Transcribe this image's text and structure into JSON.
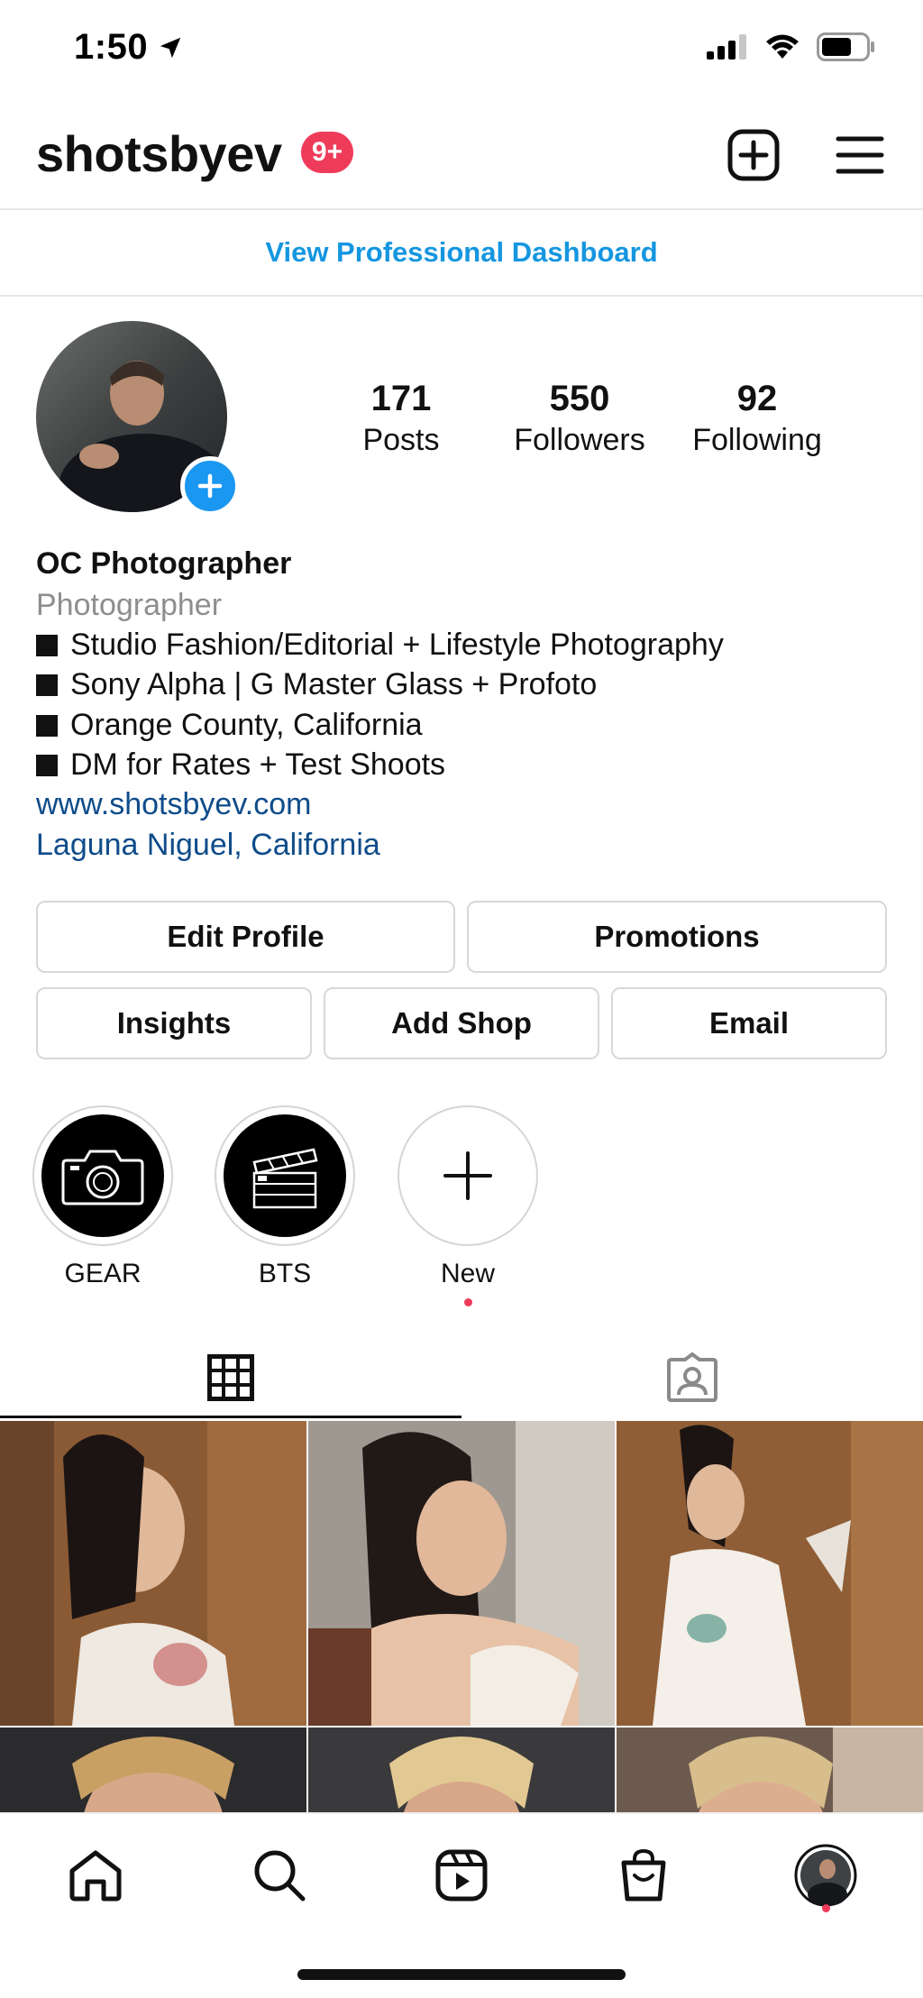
{
  "status_bar": {
    "time": "1:50",
    "icons": [
      "location-arrow-icon",
      "cellular-signal-icon",
      "wifi-icon",
      "battery-icon"
    ]
  },
  "header": {
    "username": "shotsbyev",
    "notification_badge": "9+",
    "icons": [
      "create-post-icon",
      "menu-icon"
    ]
  },
  "dashboard_link": "View Professional Dashboard",
  "stats": {
    "posts": {
      "value": "171",
      "label": "Posts"
    },
    "followers": {
      "value": "550",
      "label": "Followers"
    },
    "following": {
      "value": "92",
      "label": "Following"
    }
  },
  "bio": {
    "name": "OC Photographer",
    "category": "Photographer",
    "lines": [
      "Studio Fashion/Editorial + Lifestyle Photography",
      "Sony Alpha | G Master Glass + Profoto",
      "Orange County, California",
      "DM for Rates + Test Shoots"
    ],
    "website": "www.shotsbyev.com",
    "location": "Laguna Niguel, California"
  },
  "buttons": {
    "edit_profile": "Edit Profile",
    "promotions": "Promotions",
    "insights": "Insights",
    "add_shop": "Add Shop",
    "email": "Email"
  },
  "highlights": [
    {
      "label": "GEAR",
      "icon": "camera-icon"
    },
    {
      "label": "BTS",
      "icon": "clapperboard-icon"
    },
    {
      "label": "New",
      "icon": "plus-icon"
    }
  ],
  "tabs": [
    "grid-icon",
    "tagged-icon"
  ],
  "bottom_nav": [
    "home-icon",
    "search-icon",
    "reels-icon",
    "shop-icon",
    "profile-avatar"
  ],
  "colors": {
    "accent_blue": "#1596e0",
    "link_blue": "#0f4c8a",
    "badge_red": "#ef3b5a",
    "plus_blue": "#1a97f0"
  }
}
